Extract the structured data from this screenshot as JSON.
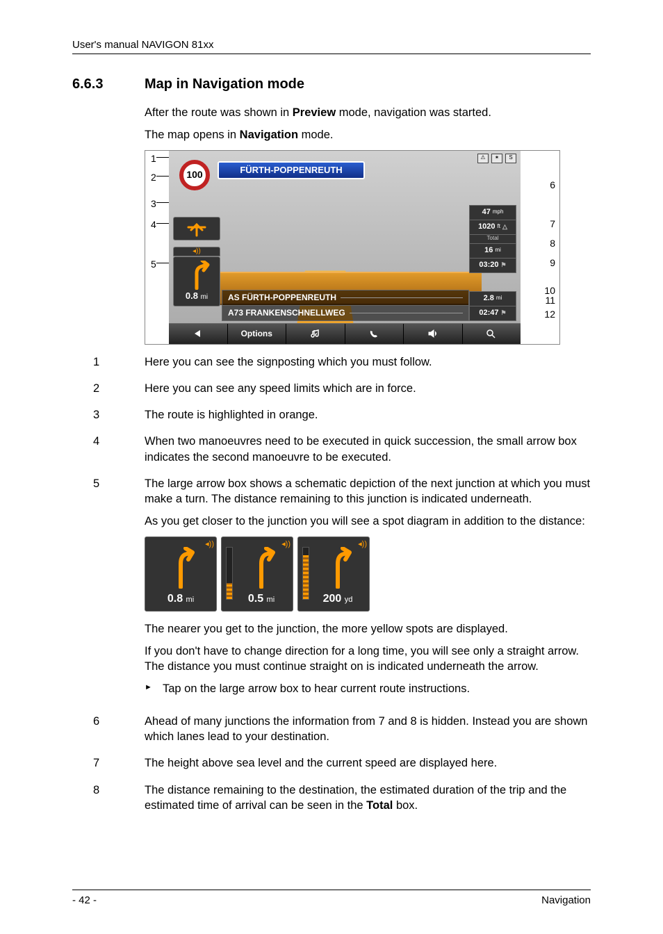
{
  "header": {
    "text": "User's manual NAVIGON 81xx"
  },
  "section": {
    "number": "6.6.3",
    "title": "Map in Navigation mode"
  },
  "intro": {
    "p1_pre": "After the route was shown in ",
    "p1_bold": "Preview",
    "p1_post": " mode, navigation was started.",
    "p2_pre": "The map opens in ",
    "p2_bold": "Navigation",
    "p2_post": " mode."
  },
  "screenshot": {
    "signpost": "FÜRTH-POPPENREUTH",
    "speed_limit": "100",
    "top_icons": {
      "a": "⚠",
      "b": "✶",
      "c": "S"
    },
    "speed_value": "47",
    "speed_unit": "mph",
    "altitude_value": "1020",
    "altitude_unit": "ft",
    "total_label": "Total",
    "total_dist_value": "16",
    "total_dist_unit": "mi",
    "total_time": "03:20",
    "dest_dist_value": "2.8",
    "dest_dist_unit": "mi",
    "dest_time": "02:47",
    "street1": "AS FÜRTH-POPPENREUTH",
    "street2": "A73 FRANKENSCHNELLWEG",
    "turn_dist_value": "0.8",
    "turn_dist_unit": "mi",
    "options_label": "Options",
    "callouts_left": [
      "1",
      "2",
      "3",
      "4",
      "5"
    ],
    "callouts_right": [
      "6",
      "7",
      "8",
      "9",
      "10",
      "11",
      "12"
    ]
  },
  "list": {
    "i1": {
      "num": "1",
      "text": "Here you can see the signposting which you must follow."
    },
    "i2": {
      "num": "2",
      "text": "Here you can see any speed limits which are in force."
    },
    "i3": {
      "num": "3",
      "text": "The route is highlighted in orange."
    },
    "i4": {
      "num": "4",
      "text": "When two manoeuvres need to be executed in quick succession, the small arrow box indicates the second manoeuvre to be executed."
    },
    "i5": {
      "num": "5",
      "p1": "The large arrow box shows a schematic depiction of the next junction at which you must make a turn. The distance remaining to this junction is indicated underneath.",
      "p2": "As you get closer to the junction you will see a spot diagram in addition to the distance:",
      "ex1_val": "0.8",
      "ex1_unit": "mi",
      "ex2_val": "0.5",
      "ex2_unit": "mi",
      "ex3_val": "200",
      "ex3_unit": "yd",
      "p3": "The nearer you get to the junction, the more yellow spots are displayed.",
      "p4": "If you don't have to change direction for a long time, you will see only a straight arrow. The distance you must continue straight on is indicated underneath the arrow.",
      "bullet": "Tap on the large arrow box to hear current route instructions."
    },
    "i6": {
      "num": "6",
      "text": "Ahead of many junctions the information from 7 and 8 is hidden. Instead you are shown which lanes lead to your destination."
    },
    "i7": {
      "num": "7",
      "text": "The height above sea level and the current speed are displayed here."
    },
    "i8": {
      "num": "8",
      "pre": "The distance remaining to the destination, the estimated duration of the trip and the estimated time of arrival can be seen in the ",
      "bold": "Total",
      "post": " box."
    }
  },
  "footer": {
    "page": "- 42 -",
    "section": "Navigation"
  }
}
